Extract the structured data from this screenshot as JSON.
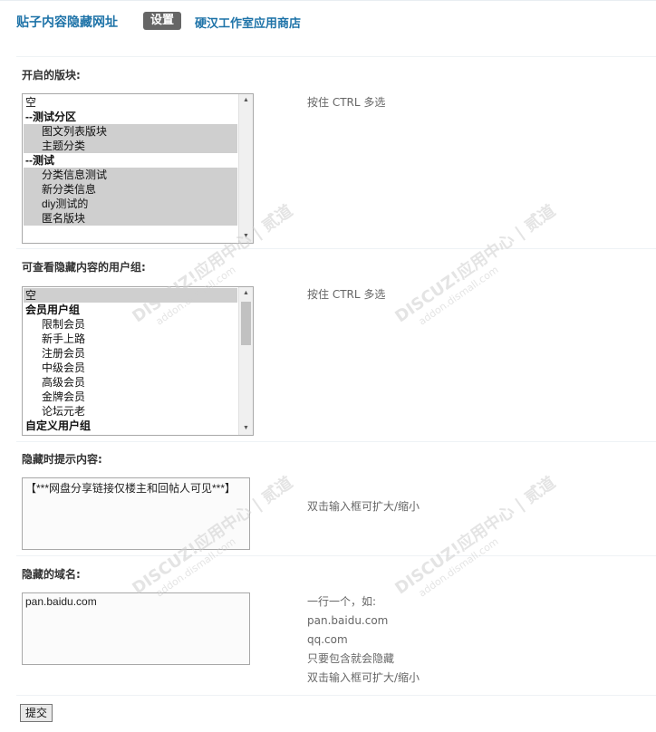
{
  "header": {
    "title": "贴子内容隐藏网址",
    "active_tab": "设置",
    "shop_link": "硬汉工作室应用商店"
  },
  "sections": {
    "forums": {
      "label": "开启的版块:",
      "hint": "按住 CTRL 多选",
      "options": [
        {
          "text": "空",
          "type": "plain",
          "selected": false
        },
        {
          "text": "--测试分区",
          "type": "group",
          "selected": false
        },
        {
          "text": "图文列表版块",
          "type": "indent",
          "selected": true
        },
        {
          "text": "主题分类",
          "type": "indent",
          "selected": true
        },
        {
          "text": "--测试",
          "type": "group",
          "selected": false
        },
        {
          "text": "分类信息测试",
          "type": "indent",
          "selected": true
        },
        {
          "text": "新分类信息",
          "type": "indent",
          "selected": true
        },
        {
          "text": "diy测试的",
          "type": "indent",
          "selected": true
        },
        {
          "text": "匿名版块",
          "type": "indent",
          "selected": true
        }
      ]
    },
    "usergroups": {
      "label": "可查看隐藏内容的用户组:",
      "hint": "按住 CTRL 多选",
      "options": [
        {
          "text": "空",
          "type": "plain",
          "selected": true
        },
        {
          "text": "会员用户组",
          "type": "group",
          "selected": false
        },
        {
          "text": "限制会员",
          "type": "indent",
          "selected": false
        },
        {
          "text": "新手上路",
          "type": "indent",
          "selected": false
        },
        {
          "text": "注册会员",
          "type": "indent",
          "selected": false
        },
        {
          "text": "中级会员",
          "type": "indent",
          "selected": false
        },
        {
          "text": "高级会员",
          "type": "indent",
          "selected": false
        },
        {
          "text": "金牌会员",
          "type": "indent",
          "selected": false
        },
        {
          "text": "论坛元老",
          "type": "indent",
          "selected": false
        },
        {
          "text": "自定义用户组",
          "type": "group",
          "selected": false
        }
      ]
    },
    "tip": {
      "label": "隐藏时提示内容:",
      "value": "【***网盘分享链接仅楼主和回帖人可见***】",
      "hint": "双击输入框可扩大/缩小"
    },
    "domains": {
      "label": "隐藏的域名:",
      "value": "pan.baidu.com",
      "hint_lines": [
        "一行一个，如:",
        "pan.baidu.com",
        "qq.com",
        "只要包含就会隐藏",
        "双击输入框可扩大/缩小"
      ]
    }
  },
  "submit_label": "提交",
  "watermark": {
    "brand": "DISCUZ!应用中心 | 贰道",
    "url": "addon.dismall.com"
  }
}
